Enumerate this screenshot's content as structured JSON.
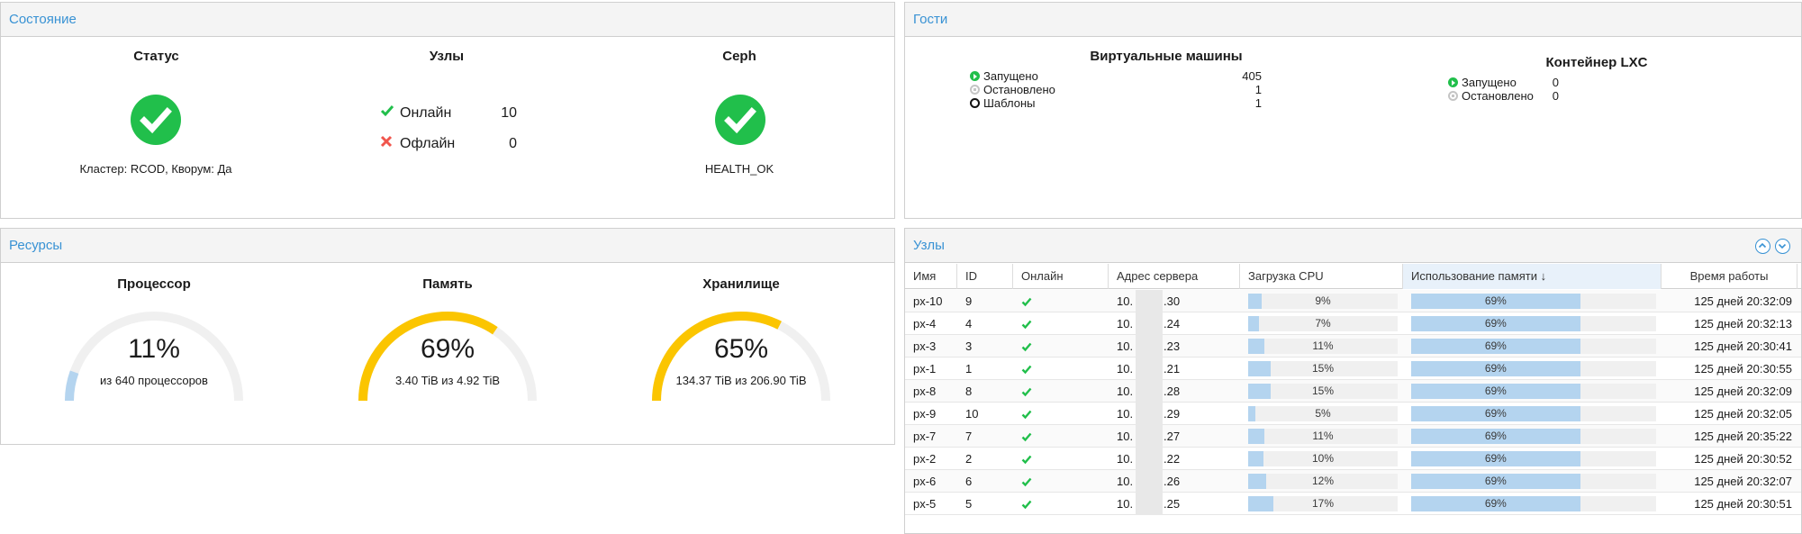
{
  "status_panel": {
    "title": "Состояние",
    "status": {
      "heading": "Статус",
      "caption": "Кластер: RCOD, Кворум: Да"
    },
    "nodes": {
      "heading": "Узлы",
      "online_label": "Онлайн",
      "online_count": "10",
      "offline_label": "Офлайн",
      "offline_count": "0"
    },
    "ceph": {
      "heading": "Ceph",
      "caption": "HEALTH_OK"
    }
  },
  "guests_panel": {
    "title": "Гости",
    "vms": {
      "heading": "Виртуальные машины",
      "items": [
        {
          "label": "Запущено",
          "value": "405",
          "icon": "running"
        },
        {
          "label": "Остановлено",
          "value": "1",
          "icon": "stopped"
        },
        {
          "label": "Шаблоны",
          "value": "1",
          "icon": "template"
        }
      ]
    },
    "lxc": {
      "heading": "Контейнер LXC",
      "items": [
        {
          "label": "Запущено",
          "value": "0",
          "icon": "running"
        },
        {
          "label": "Остановлено",
          "value": "0",
          "icon": "stopped"
        }
      ]
    }
  },
  "resources_panel": {
    "title": "Ресурсы",
    "gauges": [
      {
        "heading": "Процессор",
        "percent_label": "11%",
        "fraction": 0.11,
        "caption": "из 640 процессоров",
        "color": "#b4d4ef"
      },
      {
        "heading": "Память",
        "percent_label": "69%",
        "fraction": 0.69,
        "caption": "3.40 TiB из 4.92 TiB",
        "color": "#fbc500"
      },
      {
        "heading": "Хранилище",
        "percent_label": "65%",
        "fraction": 0.65,
        "caption": "134.37 TiB из 206.90 TiB",
        "color": "#fbc500"
      }
    ]
  },
  "nodes_panel": {
    "title": "Узлы",
    "columns": {
      "name": "Имя",
      "id": "ID",
      "online": "Онлайн",
      "address": "Адрес сервера",
      "cpu": "Загрузка CPU",
      "mem": "Использование памяти ↓",
      "uptime": "Время работы"
    },
    "rows": [
      {
        "name": "px-10",
        "id": "9",
        "addr_prefix": "10.",
        "addr_suffix": ".30",
        "cpu": "9%",
        "cpu_frac": 0.09,
        "mem": "69%",
        "mem_frac": 0.69,
        "uptime": "125 дней 20:32:09"
      },
      {
        "name": "px-4",
        "id": "4",
        "addr_prefix": "10.",
        "addr_suffix": ".24",
        "cpu": "7%",
        "cpu_frac": 0.07,
        "mem": "69%",
        "mem_frac": 0.69,
        "uptime": "125 дней 20:32:13"
      },
      {
        "name": "px-3",
        "id": "3",
        "addr_prefix": "10.",
        "addr_suffix": ".23",
        "cpu": "11%",
        "cpu_frac": 0.11,
        "mem": "69%",
        "mem_frac": 0.69,
        "uptime": "125 дней 20:30:41"
      },
      {
        "name": "px-1",
        "id": "1",
        "addr_prefix": "10.",
        "addr_suffix": ".21",
        "cpu": "15%",
        "cpu_frac": 0.15,
        "mem": "69%",
        "mem_frac": 0.69,
        "uptime": "125 дней 20:30:55"
      },
      {
        "name": "px-8",
        "id": "8",
        "addr_prefix": "10.",
        "addr_suffix": ".28",
        "cpu": "15%",
        "cpu_frac": 0.15,
        "mem": "69%",
        "mem_frac": 0.69,
        "uptime": "125 дней 20:32:09"
      },
      {
        "name": "px-9",
        "id": "10",
        "addr_prefix": "10.",
        "addr_suffix": ".29",
        "cpu": "5%",
        "cpu_frac": 0.05,
        "mem": "69%",
        "mem_frac": 0.69,
        "uptime": "125 дней 20:32:05"
      },
      {
        "name": "px-7",
        "id": "7",
        "addr_prefix": "10.",
        "addr_suffix": ".27",
        "cpu": "11%",
        "cpu_frac": 0.11,
        "mem": "69%",
        "mem_frac": 0.69,
        "uptime": "125 дней 20:35:22"
      },
      {
        "name": "px-2",
        "id": "2",
        "addr_prefix": "10.",
        "addr_suffix": ".22",
        "cpu": "10%",
        "cpu_frac": 0.1,
        "mem": "69%",
        "mem_frac": 0.69,
        "uptime": "125 дней 20:30:52"
      },
      {
        "name": "px-6",
        "id": "6",
        "addr_prefix": "10.",
        "addr_suffix": ".26",
        "cpu": "12%",
        "cpu_frac": 0.12,
        "mem": "69%",
        "mem_frac": 0.69,
        "uptime": "125 дней 20:32:07"
      },
      {
        "name": "px-5",
        "id": "5",
        "addr_prefix": "10.",
        "addr_suffix": ".25",
        "cpu": "17%",
        "cpu_frac": 0.17,
        "mem": "69%",
        "mem_frac": 0.69,
        "uptime": "125 дней 20:30:51"
      }
    ]
  },
  "colors": {
    "accent": "#3892d4",
    "ok": "#21bf4b",
    "error": "#f0554c",
    "warn": "#fbc500",
    "bar": "#b4d4ef"
  }
}
